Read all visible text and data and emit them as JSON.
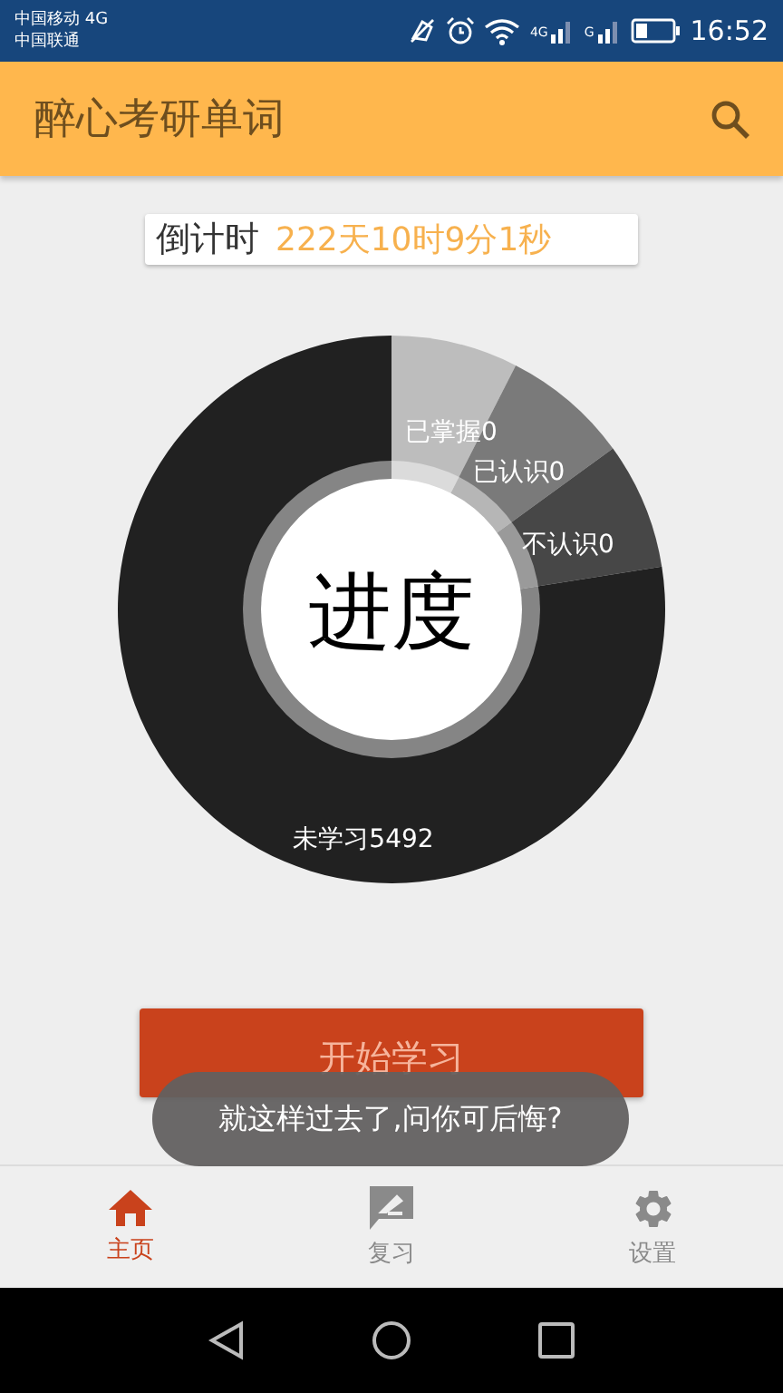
{
  "status_bar": {
    "carrier_1": "中国移动 4G",
    "carrier_2": "中国联通",
    "signal_1_label": "4G",
    "signal_2_label": "G",
    "time": "16:52"
  },
  "app_bar": {
    "title": "醉心考研单词"
  },
  "countdown": {
    "label": "倒计时",
    "value": "222天10时9分1秒"
  },
  "progress": {
    "center_label": "进度",
    "segments": [
      {
        "label": "已掌握0",
        "color": "#bdbdbd"
      },
      {
        "label": "已认识0",
        "color": "#7a7a7a"
      },
      {
        "label": "不认识0",
        "color": "#474747"
      },
      {
        "label": "未学习5492",
        "color": "#212121"
      }
    ]
  },
  "start_button": {
    "label": "开始学习"
  },
  "toast": {
    "message": "就这样过去了,问你可后悔?"
  },
  "bottom_nav": [
    {
      "label": "主页",
      "kind": "home",
      "selected": true
    },
    {
      "label": "复习",
      "kind": "review",
      "selected": false
    },
    {
      "label": "设置",
      "kind": "settings",
      "selected": false
    }
  ]
}
